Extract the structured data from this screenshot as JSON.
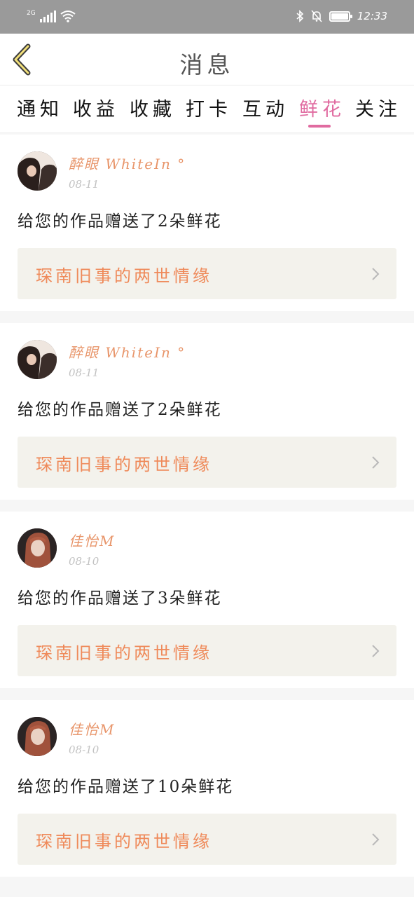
{
  "status_bar": {
    "network": "2G",
    "time": "12:33",
    "icons": [
      "signal-icon",
      "wifi-icon",
      "bluetooth-icon",
      "bell-off-icon",
      "battery-icon"
    ]
  },
  "nav": {
    "title": "消息",
    "back_icon": "chevron-left-icon"
  },
  "tabs": [
    {
      "label": "通知",
      "active": false
    },
    {
      "label": "收益",
      "active": false
    },
    {
      "label": "收藏",
      "active": false
    },
    {
      "label": "打卡",
      "active": false
    },
    {
      "label": "互动",
      "active": false
    },
    {
      "label": "鲜花",
      "active": true
    },
    {
      "label": "关注",
      "active": false
    }
  ],
  "messages": [
    {
      "user": "醉眼 WhiteIn °",
      "date": "08-11",
      "text": "给您的作品赠送了2朵鲜花",
      "work_title": "琛南旧事的两世情缘"
    },
    {
      "user": "醉眼 WhiteIn °",
      "date": "08-11",
      "text": "给您的作品赠送了2朵鲜花",
      "work_title": "琛南旧事的两世情缘"
    },
    {
      "user": "佳怡M",
      "date": "08-10",
      "text": "给您的作品赠送了3朵鲜花",
      "work_title": "琛南旧事的两世情缘"
    },
    {
      "user": "佳怡M",
      "date": "08-10",
      "text": "给您的作品赠送了10朵鲜花",
      "work_title": "琛南旧事的两世情缘"
    }
  ],
  "colors": {
    "accent": "#e06ba0",
    "username": "#e8956a",
    "work_title": "#ef8a5a",
    "work_bg": "#f3f2ec",
    "status_bar": "#9a9a9a"
  }
}
